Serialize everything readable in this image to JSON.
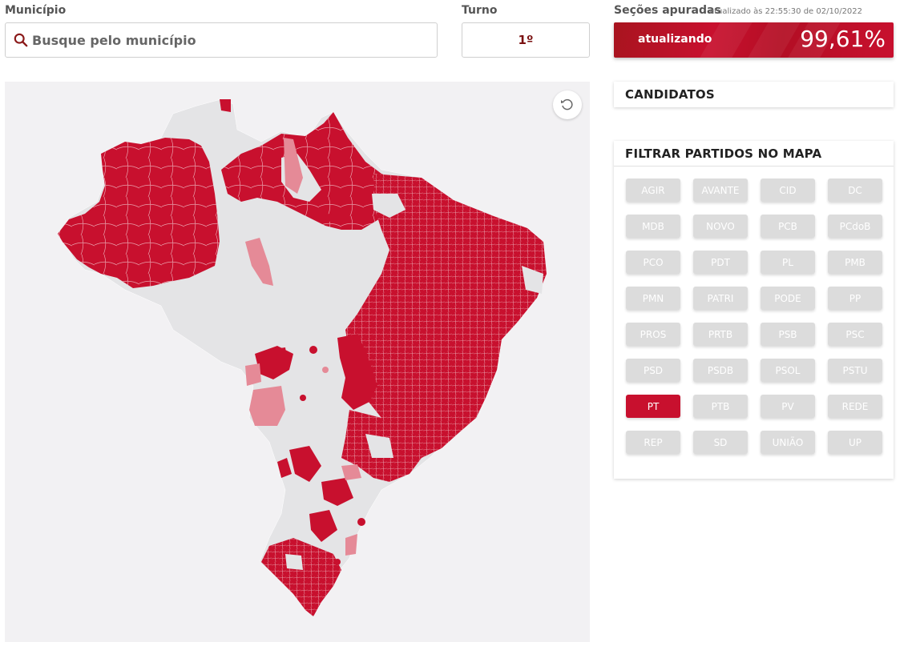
{
  "search": {
    "label": "Município",
    "placeholder": "Busque pelo município"
  },
  "turno": {
    "label": "Turno",
    "value": "1º"
  },
  "secoes": {
    "title": "Seções apuradas",
    "updated": "atualizado às 22:55:30 de 02/10/2022",
    "status": "atualizando",
    "percent": "99,61%"
  },
  "map": {
    "fill_colors": {
      "winner": "#c8102e",
      "partial": "#e58a97",
      "other": "#e4e4e6"
    }
  },
  "candidatos": {
    "title": "CANDIDATOS"
  },
  "filter": {
    "title": "FILTRAR PARTIDOS NO MAPA",
    "parties": [
      "AGIR",
      "AVANTE",
      "CID",
      "DC",
      "MDB",
      "NOVO",
      "PCB",
      "PCdoB",
      "PCO",
      "PDT",
      "PL",
      "PMB",
      "PMN",
      "PATRI",
      "PODE",
      "PP",
      "PROS",
      "PRTB",
      "PSB",
      "PSC",
      "PSD",
      "PSDB",
      "PSOL",
      "PSTU",
      "PT",
      "PTB",
      "PV",
      "REDE",
      "REP",
      "SD",
      "UNIÃO",
      "UP"
    ],
    "active": "PT"
  },
  "colors": {
    "accent": "#c8102e",
    "button_inactive": "#dcdcdc"
  }
}
